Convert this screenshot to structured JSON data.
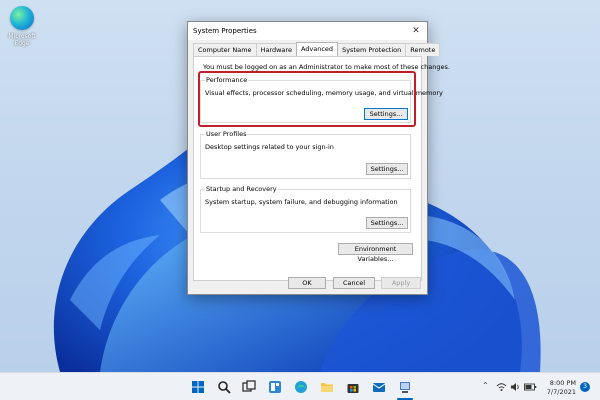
{
  "desktop": {
    "icons": [
      {
        "label": "Microsoft Edge",
        "icon": "edge-icon"
      }
    ]
  },
  "dialog": {
    "title": "System Properties",
    "tabs": [
      {
        "label": "Computer Name"
      },
      {
        "label": "Hardware"
      },
      {
        "label": "Advanced",
        "active": true
      },
      {
        "label": "System Protection"
      },
      {
        "label": "Remote"
      }
    ],
    "notice": "You must be logged on as an Administrator to make most of these changes.",
    "performance": {
      "legend": "Performance",
      "description": "Visual effects, processor scheduling, memory usage, and virtual memory",
      "button": "Settings..."
    },
    "user_profiles": {
      "legend": "User Profiles",
      "description": "Desktop settings related to your sign-in",
      "button": "Settings..."
    },
    "startup_recovery": {
      "legend": "Startup and Recovery",
      "description": "System startup, system failure, and debugging information",
      "button": "Settings..."
    },
    "env_button": "Environment Variables...",
    "ok": "OK",
    "cancel": "Cancel",
    "apply": "Apply",
    "highlight_color": "#c21f2a"
  },
  "taskbar": {
    "icons": [
      "start-icon",
      "search-icon",
      "task-view-icon",
      "widgets-icon",
      "edge-icon",
      "file-explorer-icon",
      "store-icon",
      "mail-icon",
      "system-properties-icon"
    ],
    "time": "8:00 PM",
    "date": "7/7/2021",
    "notification_count": "3",
    "accent": "#0067c0"
  }
}
